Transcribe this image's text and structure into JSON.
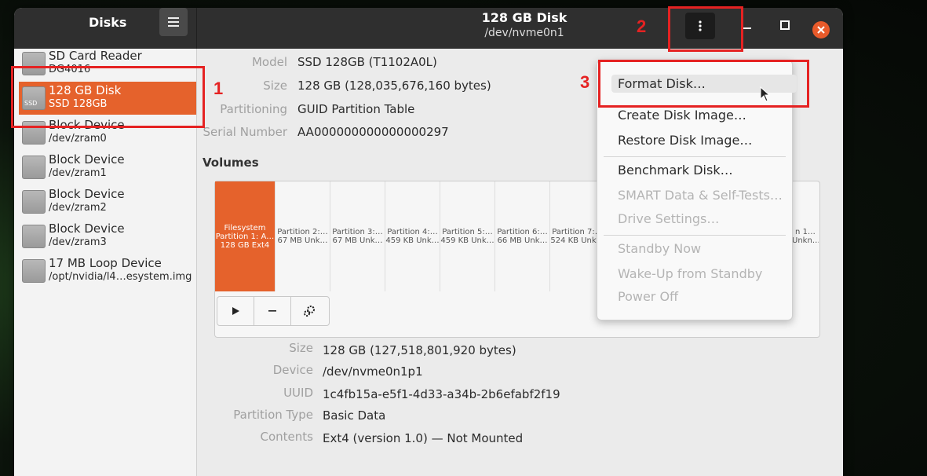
{
  "app": {
    "title": "Disks",
    "window_title": "128 GB Disk",
    "window_subtitle": "/dev/nvme0n1"
  },
  "icons": {
    "hamburger": "hamburger-menu-icon",
    "kebab": "vertical-dots-menu-icon",
    "minimize": "minimize-icon",
    "maximize": "maximize-icon",
    "close": "close-icon"
  },
  "sidebar": {
    "items": [
      {
        "name": "SD Card Reader",
        "sub": "DG4016",
        "icon_tag": "",
        "selected": false
      },
      {
        "name": "128 GB Disk",
        "sub": "SSD 128GB",
        "icon_tag": "SSD",
        "selected": true
      },
      {
        "name": "Block Device",
        "sub": "/dev/zram0",
        "icon_tag": "",
        "selected": false
      },
      {
        "name": "Block Device",
        "sub": "/dev/zram1",
        "icon_tag": "",
        "selected": false
      },
      {
        "name": "Block Device",
        "sub": "/dev/zram2",
        "icon_tag": "",
        "selected": false
      },
      {
        "name": "Block Device",
        "sub": "/dev/zram3",
        "icon_tag": "",
        "selected": false
      },
      {
        "name": "17 MB Loop Device",
        "sub": "/opt/nvidia/l4…esystem.img",
        "icon_tag": "",
        "selected": false
      }
    ]
  },
  "disk_info": {
    "model_label": "Model",
    "model_value": "SSD 128GB (T1102A0L)",
    "size_label": "Size",
    "size_value": "128 GB (128,035,676,160 bytes)",
    "partitioning_label": "Partitioning",
    "partitioning_value": "GUID Partition Table",
    "serial_label": "Serial Number",
    "serial_value": "AA000000000000000297"
  },
  "volumes": {
    "title": "Volumes",
    "partitions": [
      {
        "line1": "Filesystem",
        "line2": "Partition 1: A…",
        "line3": "128 GB Ext4",
        "selected": true
      },
      {
        "line1": "",
        "line2": "Partition 2:…",
        "line3": "67 MB Unk…",
        "selected": false
      },
      {
        "line1": "",
        "line2": "Partition 3:…",
        "line3": "67 MB Unk…",
        "selected": false
      },
      {
        "line1": "",
        "line2": "Partition 4:…",
        "line3": "459 KB Unk…",
        "selected": false
      },
      {
        "line1": "",
        "line2": "Partition 5:…",
        "line3": "459 KB Unk…",
        "selected": false
      },
      {
        "line1": "",
        "line2": "Partition 6:…",
        "line3": "66 MB Unk…",
        "selected": false
      },
      {
        "line1": "",
        "line2": "Partition 7:…",
        "line3": "524 KB Unk…",
        "selected": false
      },
      {
        "line1": "",
        "line2": "n 1…",
        "line3": "Unkn…",
        "selected": false
      }
    ],
    "toolbar": [
      "play-icon",
      "minus-icon",
      "gears-icon"
    ]
  },
  "volume_info": {
    "size_label": "Size",
    "size_value": "128 GB (127,518,801,920 bytes)",
    "device_label": "Device",
    "device_value": "/dev/nvme0n1p1",
    "uuid_label": "UUID",
    "uuid_value": "1c4fb15a-e5f1-4d33-a34b-2b6efabf2f19",
    "ptype_label": "Partition Type",
    "ptype_value": "Basic Data",
    "contents_label": "Contents",
    "contents_value": "Ext4 (version 1.0) — Not Mounted"
  },
  "menu": {
    "format_disk": "Format Disk…",
    "create_image": "Create Disk Image…",
    "restore_image": "Restore Disk Image…",
    "benchmark": "Benchmark Disk…",
    "smart": "SMART Data & Self-Tests…",
    "drive_settings": "Drive Settings…",
    "standby": "Standby Now",
    "wakeup": "Wake-Up from Standby",
    "power_off": "Power Off"
  },
  "annotations": {
    "n1": "1",
    "n2": "2",
    "n3": "3",
    "color": "#e52222"
  },
  "colors": {
    "accent": "#e5622c",
    "headerbar": "#2f2f2f",
    "close": "#e85a2a"
  }
}
